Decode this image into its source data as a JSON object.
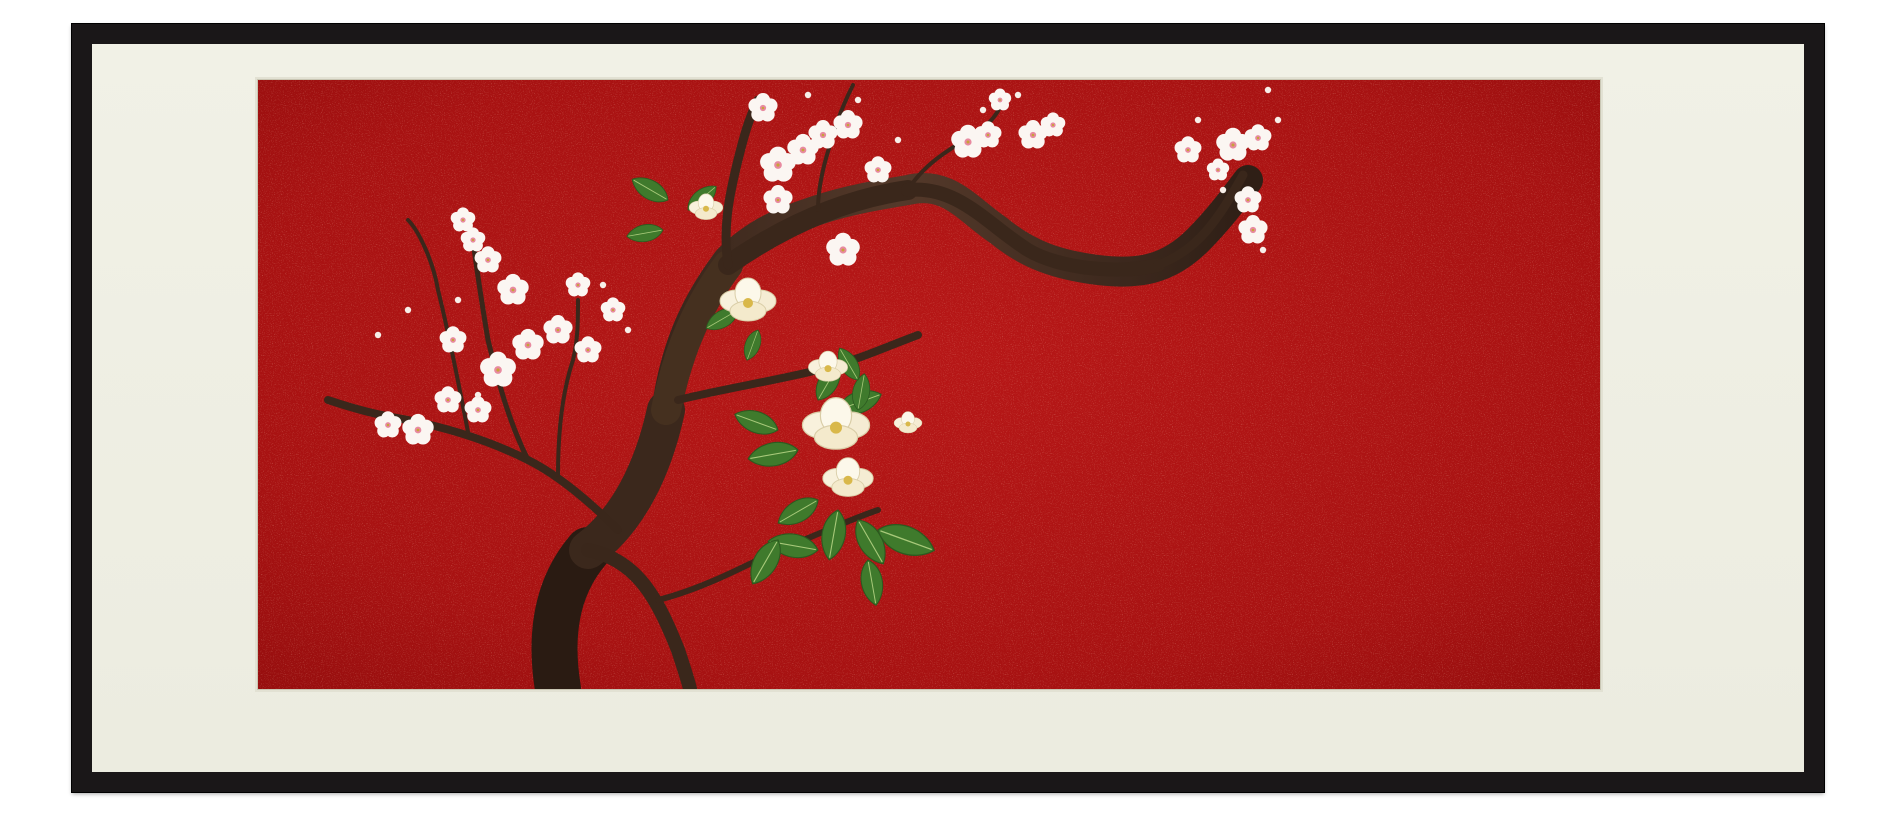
{
  "artwork": {
    "colors": {
      "frame": "#1a1718",
      "mat": "#eeeee3",
      "background_red": "#b01414",
      "branch": "#3f2a1e",
      "leaf": "#3e7a2a",
      "blossom": "#fbf6f2",
      "magnolia": "#f8f1dc"
    },
    "icons": [
      "plum-blossom-icon",
      "magnolia-flower-icon",
      "leaf-icon"
    ]
  }
}
